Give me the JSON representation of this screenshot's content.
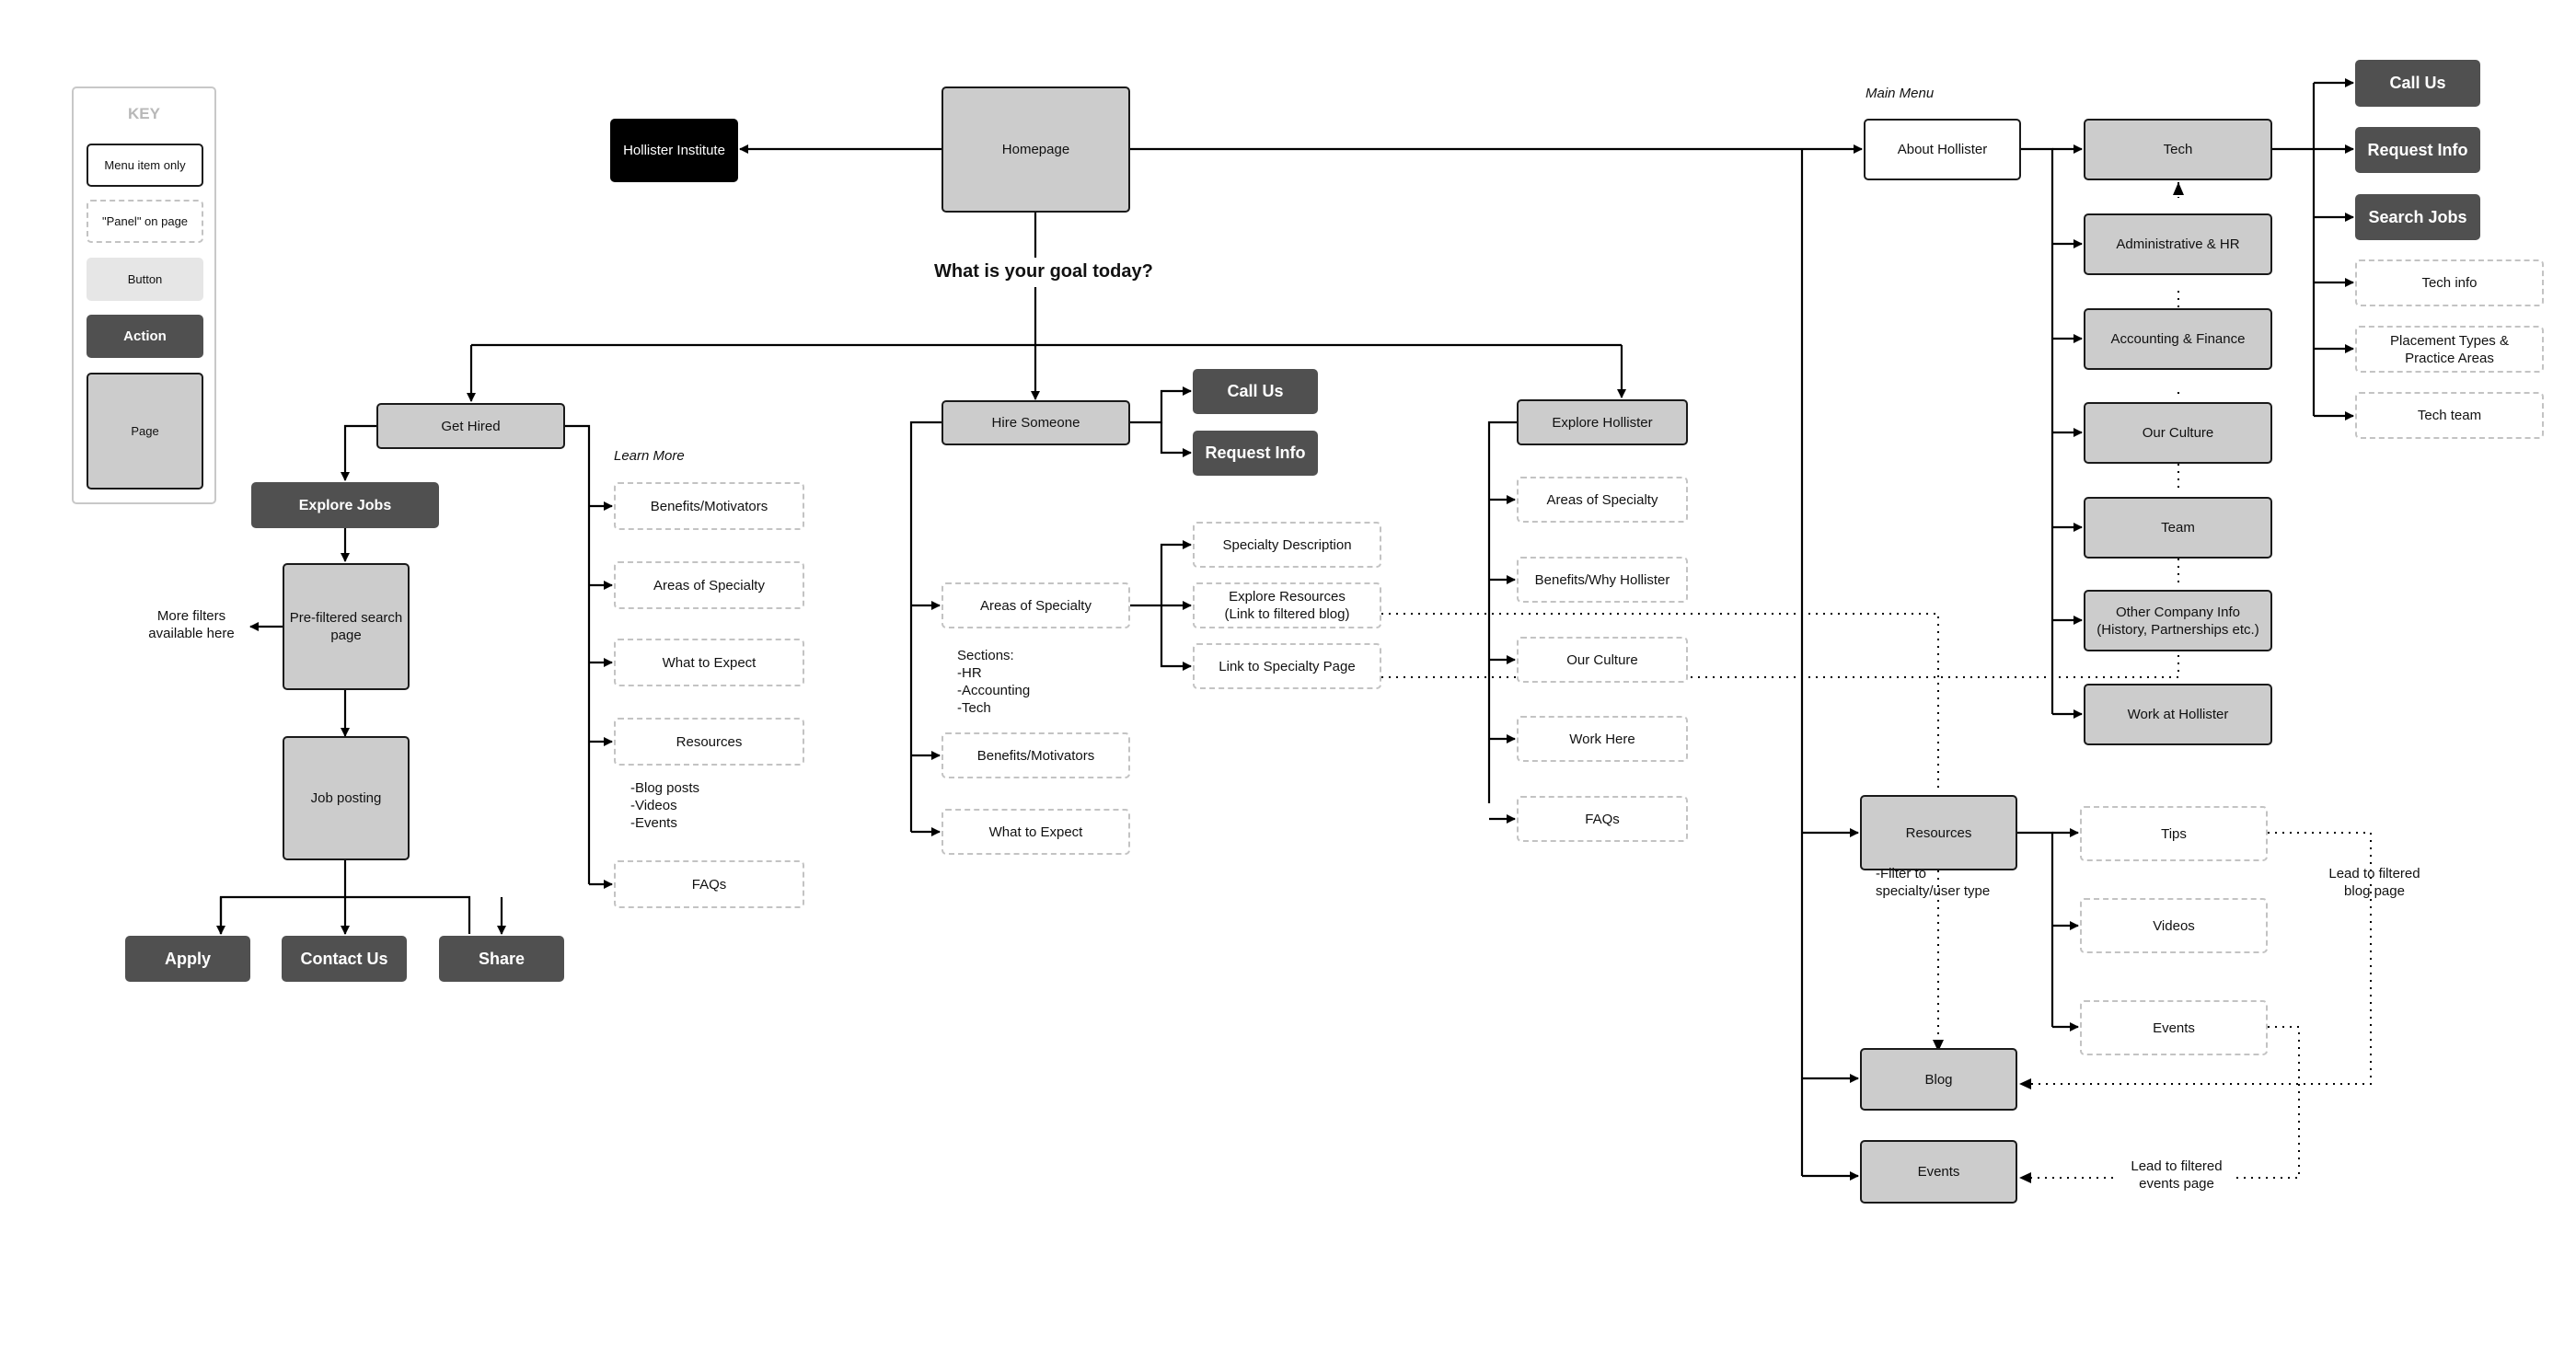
{
  "key": {
    "title": "KEY",
    "items": [
      {
        "label": "Menu item only",
        "type": "menu"
      },
      {
        "label": "\"Panel\" on page",
        "type": "panel"
      },
      {
        "label": "Button",
        "type": "button"
      },
      {
        "label": "Action",
        "type": "action"
      },
      {
        "label": "Page",
        "type": "page"
      }
    ]
  },
  "top": {
    "hollister_institute": "Hollister Institute",
    "homepage": "Homepage",
    "question": "What is your goal today?",
    "main_menu_label": "Main Menu",
    "about_hollister": "About Hollister"
  },
  "get_hired": {
    "title": "Get Hired",
    "explore_jobs": "Explore Jobs",
    "prefiltered": "Pre-filtered search\npage",
    "more_filters_note": "More filters\navailable here",
    "job_posting": "Job posting",
    "actions": [
      "Apply",
      "Contact Us",
      "Share"
    ],
    "learn_more_label": "Learn More",
    "panels": [
      "Benefits/Motivators",
      "Areas of Specialty",
      "What to Expect",
      "Resources",
      "FAQs"
    ],
    "resources_note": "-Blog posts\n-Videos\n-Events"
  },
  "hire_someone": {
    "title": "Hire Someone",
    "actions": [
      "Call Us",
      "Request Info"
    ],
    "panels": [
      "Areas of Specialty",
      "Benefits/Motivators",
      "What to Expect"
    ],
    "sections_note": "Sections:\n-HR\n-Accounting\n-Tech",
    "specialty_subpanels": [
      "Specialty Description",
      "Explore Resources\n(Link to filtered blog)",
      "Link to Specialty Page"
    ]
  },
  "explore_hollister": {
    "title": "Explore Hollister",
    "panels": [
      "Areas of Specialty",
      "Benefits/Why Hollister",
      "Our Culture",
      "Work Here",
      "FAQs"
    ]
  },
  "about": {
    "pages": [
      "Tech",
      "Administrative & HR",
      "Accounting & Finance",
      "Our Culture",
      "Team",
      "Other Company Info\n(History, Partnerships etc.)",
      "Work at Hollister"
    ],
    "tech_actions": [
      "Call Us",
      "Request Info",
      "Search Jobs"
    ],
    "tech_panels": [
      "Tech info",
      "Placement Types &\nPractice Areas",
      "Tech team"
    ]
  },
  "resources": {
    "title": "Resources",
    "filter_note": "-Filter to\nspecialty/user type",
    "panels": [
      "Tips",
      "Videos",
      "Events"
    ],
    "blog": "Blog",
    "events": "Events",
    "blog_note": "Lead to filtered\nblog page",
    "events_note": "Lead to filtered\nevents page"
  },
  "colors": {
    "page_fill": "#cccccc",
    "action_fill": "#505050",
    "panel_border": "#c3c3c3",
    "institute_fill": "#000000",
    "button_fill": "#e6e6e6"
  }
}
